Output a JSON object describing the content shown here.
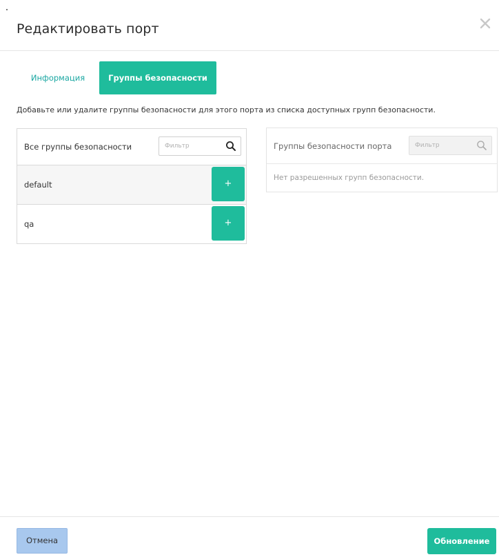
{
  "modal": {
    "title": "Редактировать порт"
  },
  "tabs": [
    {
      "label": "Информация",
      "active": false
    },
    {
      "label": "Группы безопасности",
      "active": true
    }
  ],
  "intro_text": "Добавьте или удалите группы безопасности для этого порта из списка доступных групп безопасности.",
  "available": {
    "heading": "Все группы безопасности",
    "filter_placeholder": "Фильтр",
    "items": [
      {
        "name": "default",
        "action": "+"
      },
      {
        "name": "qa",
        "action": "+"
      }
    ]
  },
  "allocated": {
    "heading": "Группы безопасности порта",
    "filter_placeholder": "Фильтр",
    "empty_text": "Нет разрешенных групп безопасности."
  },
  "footer": {
    "cancel_label": "Отмена",
    "submit_label": "Обновление"
  },
  "colors": {
    "accent": "#1fbc9c",
    "tab_link": "#1aa7a2",
    "cancel_bg": "#a8c8ee"
  },
  "icons": {
    "close": "close-icon",
    "search": "search-icon",
    "add": "plus-icon"
  }
}
